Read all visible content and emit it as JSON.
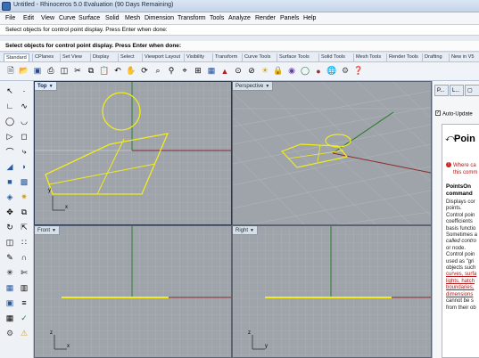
{
  "window": {
    "title": "Untitled - Rhinoceros 5.0 Evaluation (90 Days Remaining)"
  },
  "menu": [
    "File",
    "Edit",
    "View",
    "Curve",
    "Surface",
    "Solid",
    "Mesh",
    "Dimension",
    "Transform",
    "Tools",
    "Analyze",
    "Render",
    "Panels",
    "Help"
  ],
  "command": {
    "history": "Select objects for control point display. Press Enter when done:",
    "prompt": "Select objects for control point display. Press Enter when done:"
  },
  "toolbar_tabs": [
    "Standard",
    "CPlanes",
    "Set View",
    "Display",
    "Select",
    "Viewport Layout",
    "Visibility",
    "Transform",
    "Curve Tools",
    "Surface Tools",
    "Solid Tools",
    "Mesh Tools",
    "Render Tools",
    "Drafting",
    "New in V5"
  ],
  "toolbar_icons": [
    "new-icon",
    "open-icon",
    "save-icon",
    "print-icon",
    "properties-icon",
    "cut-icon",
    "copy-icon",
    "paste-icon",
    "undo-icon",
    "pan-icon",
    "rotate-icon",
    "zoom-window-icon",
    "zoom-extents-icon",
    "zoom-selected-icon",
    "four-viewports-icon",
    "layer-icon",
    "car-icon",
    "point-on-icon",
    "point-off-icon",
    "display-icon",
    "lock-icon",
    "render-icon",
    "material-icon",
    "sun-icon",
    "globe-icon",
    "settings-icon",
    "help-icon"
  ],
  "left_tools": [
    "select-arrow-icon",
    "point-icon",
    "polyline-icon",
    "curve-icon",
    "circle-icon",
    "arc-icon",
    "rectangle-icon",
    "polygon-icon",
    "fillet-icon",
    "offset-icon",
    "surface-icon",
    "extrude-icon",
    "box-icon",
    "mesh-icon",
    "boolean-icon",
    "light-icon",
    "move-icon",
    "copy-tool-icon",
    "rotate-tool-icon",
    "scale-icon",
    "mirror-icon",
    "array-icon",
    "split-icon",
    "join-icon",
    "explode-icon",
    "trim-icon",
    "group-icon",
    "ungroup-icon",
    "dimension-icon",
    "text-icon",
    "grid-icon",
    "check-icon",
    "analyze-icon",
    "render-tool-icon"
  ],
  "viewports": {
    "top": {
      "label": "Top",
      "axis_x": "x",
      "axis_y": "y"
    },
    "perspective": {
      "label": "Perspective"
    },
    "front": {
      "label": "Front",
      "axis_x": "x",
      "axis_y": "z"
    },
    "right": {
      "label": "Right",
      "axis_x": "y",
      "axis_y": "z"
    }
  },
  "right_panel": {
    "tabs": [
      "P...",
      "L..."
    ],
    "auto_update": "Auto-Update",
    "help_title": "Poin",
    "warning_line1": "Where ca",
    "warning_line2": "this comm",
    "cmd_name_line1": "PointsOn",
    "cmd_name_line2": "command",
    "body_lines": [
      "Displays cor",
      "points.",
      "Control poin",
      "coefficients",
      "basis functio",
      "Sometimes a",
      "called contro",
      "or node.",
      "Control poin",
      "used as \"gri",
      "objects such"
    ],
    "link_lines": [
      "curves, surfa",
      "lights, hatch",
      "boundaries,",
      "dimensions"
    ],
    "tail_lines": [
      "cannot be s",
      "from their ob"
    ]
  },
  "colors": {
    "viewport_bg": "#9ea4aa",
    "geometry": "#f2ec1c",
    "x_axis": "#8e2a2a",
    "y_axis": "#2a7a2a"
  }
}
